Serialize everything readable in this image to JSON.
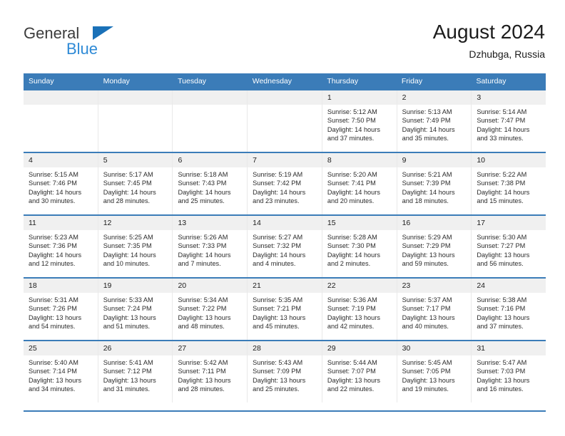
{
  "brand": {
    "name_part1": "General",
    "name_part2": "Blue",
    "triangle_color": "#1a71b8",
    "blue_text_color": "#2e8ad6"
  },
  "header": {
    "title": "August 2024",
    "subtitle": "Dzhubga, Russia"
  },
  "theme": {
    "header_blue": "#3b7cb8",
    "day_number_bg": "#f0f0f0",
    "cell_border": "#e9e9e9"
  },
  "weekdays": [
    "Sunday",
    "Monday",
    "Tuesday",
    "Wednesday",
    "Thursday",
    "Friday",
    "Saturday"
  ],
  "weeks": [
    [
      {
        "day": "",
        "empty": true,
        "sunrise": "",
        "sunset": "",
        "daylight1": "",
        "daylight2": ""
      },
      {
        "day": "",
        "empty": true,
        "sunrise": "",
        "sunset": "",
        "daylight1": "",
        "daylight2": ""
      },
      {
        "day": "",
        "empty": true,
        "sunrise": "",
        "sunset": "",
        "daylight1": "",
        "daylight2": ""
      },
      {
        "day": "",
        "empty": true,
        "sunrise": "",
        "sunset": "",
        "daylight1": "",
        "daylight2": ""
      },
      {
        "day": "1",
        "sunrise": "Sunrise: 5:12 AM",
        "sunset": "Sunset: 7:50 PM",
        "daylight1": "Daylight: 14 hours",
        "daylight2": "and 37 minutes."
      },
      {
        "day": "2",
        "sunrise": "Sunrise: 5:13 AM",
        "sunset": "Sunset: 7:49 PM",
        "daylight1": "Daylight: 14 hours",
        "daylight2": "and 35 minutes."
      },
      {
        "day": "3",
        "sunrise": "Sunrise: 5:14 AM",
        "sunset": "Sunset: 7:47 PM",
        "daylight1": "Daylight: 14 hours",
        "daylight2": "and 33 minutes."
      }
    ],
    [
      {
        "day": "4",
        "sunrise": "Sunrise: 5:15 AM",
        "sunset": "Sunset: 7:46 PM",
        "daylight1": "Daylight: 14 hours",
        "daylight2": "and 30 minutes."
      },
      {
        "day": "5",
        "sunrise": "Sunrise: 5:17 AM",
        "sunset": "Sunset: 7:45 PM",
        "daylight1": "Daylight: 14 hours",
        "daylight2": "and 28 minutes."
      },
      {
        "day": "6",
        "sunrise": "Sunrise: 5:18 AM",
        "sunset": "Sunset: 7:43 PM",
        "daylight1": "Daylight: 14 hours",
        "daylight2": "and 25 minutes."
      },
      {
        "day": "7",
        "sunrise": "Sunrise: 5:19 AM",
        "sunset": "Sunset: 7:42 PM",
        "daylight1": "Daylight: 14 hours",
        "daylight2": "and 23 minutes."
      },
      {
        "day": "8",
        "sunrise": "Sunrise: 5:20 AM",
        "sunset": "Sunset: 7:41 PM",
        "daylight1": "Daylight: 14 hours",
        "daylight2": "and 20 minutes."
      },
      {
        "day": "9",
        "sunrise": "Sunrise: 5:21 AM",
        "sunset": "Sunset: 7:39 PM",
        "daylight1": "Daylight: 14 hours",
        "daylight2": "and 18 minutes."
      },
      {
        "day": "10",
        "sunrise": "Sunrise: 5:22 AM",
        "sunset": "Sunset: 7:38 PM",
        "daylight1": "Daylight: 14 hours",
        "daylight2": "and 15 minutes."
      }
    ],
    [
      {
        "day": "11",
        "sunrise": "Sunrise: 5:23 AM",
        "sunset": "Sunset: 7:36 PM",
        "daylight1": "Daylight: 14 hours",
        "daylight2": "and 12 minutes."
      },
      {
        "day": "12",
        "sunrise": "Sunrise: 5:25 AM",
        "sunset": "Sunset: 7:35 PM",
        "daylight1": "Daylight: 14 hours",
        "daylight2": "and 10 minutes."
      },
      {
        "day": "13",
        "sunrise": "Sunrise: 5:26 AM",
        "sunset": "Sunset: 7:33 PM",
        "daylight1": "Daylight: 14 hours",
        "daylight2": "and 7 minutes."
      },
      {
        "day": "14",
        "sunrise": "Sunrise: 5:27 AM",
        "sunset": "Sunset: 7:32 PM",
        "daylight1": "Daylight: 14 hours",
        "daylight2": "and 4 minutes."
      },
      {
        "day": "15",
        "sunrise": "Sunrise: 5:28 AM",
        "sunset": "Sunset: 7:30 PM",
        "daylight1": "Daylight: 14 hours",
        "daylight2": "and 2 minutes."
      },
      {
        "day": "16",
        "sunrise": "Sunrise: 5:29 AM",
        "sunset": "Sunset: 7:29 PM",
        "daylight1": "Daylight: 13 hours",
        "daylight2": "and 59 minutes."
      },
      {
        "day": "17",
        "sunrise": "Sunrise: 5:30 AM",
        "sunset": "Sunset: 7:27 PM",
        "daylight1": "Daylight: 13 hours",
        "daylight2": "and 56 minutes."
      }
    ],
    [
      {
        "day": "18",
        "sunrise": "Sunrise: 5:31 AM",
        "sunset": "Sunset: 7:26 PM",
        "daylight1": "Daylight: 13 hours",
        "daylight2": "and 54 minutes."
      },
      {
        "day": "19",
        "sunrise": "Sunrise: 5:33 AM",
        "sunset": "Sunset: 7:24 PM",
        "daylight1": "Daylight: 13 hours",
        "daylight2": "and 51 minutes."
      },
      {
        "day": "20",
        "sunrise": "Sunrise: 5:34 AM",
        "sunset": "Sunset: 7:22 PM",
        "daylight1": "Daylight: 13 hours",
        "daylight2": "and 48 minutes."
      },
      {
        "day": "21",
        "sunrise": "Sunrise: 5:35 AM",
        "sunset": "Sunset: 7:21 PM",
        "daylight1": "Daylight: 13 hours",
        "daylight2": "and 45 minutes."
      },
      {
        "day": "22",
        "sunrise": "Sunrise: 5:36 AM",
        "sunset": "Sunset: 7:19 PM",
        "daylight1": "Daylight: 13 hours",
        "daylight2": "and 42 minutes."
      },
      {
        "day": "23",
        "sunrise": "Sunrise: 5:37 AM",
        "sunset": "Sunset: 7:17 PM",
        "daylight1": "Daylight: 13 hours",
        "daylight2": "and 40 minutes."
      },
      {
        "day": "24",
        "sunrise": "Sunrise: 5:38 AM",
        "sunset": "Sunset: 7:16 PM",
        "daylight1": "Daylight: 13 hours",
        "daylight2": "and 37 minutes."
      }
    ],
    [
      {
        "day": "25",
        "sunrise": "Sunrise: 5:40 AM",
        "sunset": "Sunset: 7:14 PM",
        "daylight1": "Daylight: 13 hours",
        "daylight2": "and 34 minutes."
      },
      {
        "day": "26",
        "sunrise": "Sunrise: 5:41 AM",
        "sunset": "Sunset: 7:12 PM",
        "daylight1": "Daylight: 13 hours",
        "daylight2": "and 31 minutes."
      },
      {
        "day": "27",
        "sunrise": "Sunrise: 5:42 AM",
        "sunset": "Sunset: 7:11 PM",
        "daylight1": "Daylight: 13 hours",
        "daylight2": "and 28 minutes."
      },
      {
        "day": "28",
        "sunrise": "Sunrise: 5:43 AM",
        "sunset": "Sunset: 7:09 PM",
        "daylight1": "Daylight: 13 hours",
        "daylight2": "and 25 minutes."
      },
      {
        "day": "29",
        "sunrise": "Sunrise: 5:44 AM",
        "sunset": "Sunset: 7:07 PM",
        "daylight1": "Daylight: 13 hours",
        "daylight2": "and 22 minutes."
      },
      {
        "day": "30",
        "sunrise": "Sunrise: 5:45 AM",
        "sunset": "Sunset: 7:05 PM",
        "daylight1": "Daylight: 13 hours",
        "daylight2": "and 19 minutes."
      },
      {
        "day": "31",
        "sunrise": "Sunrise: 5:47 AM",
        "sunset": "Sunset: 7:03 PM",
        "daylight1": "Daylight: 13 hours",
        "daylight2": "and 16 minutes."
      }
    ]
  ]
}
